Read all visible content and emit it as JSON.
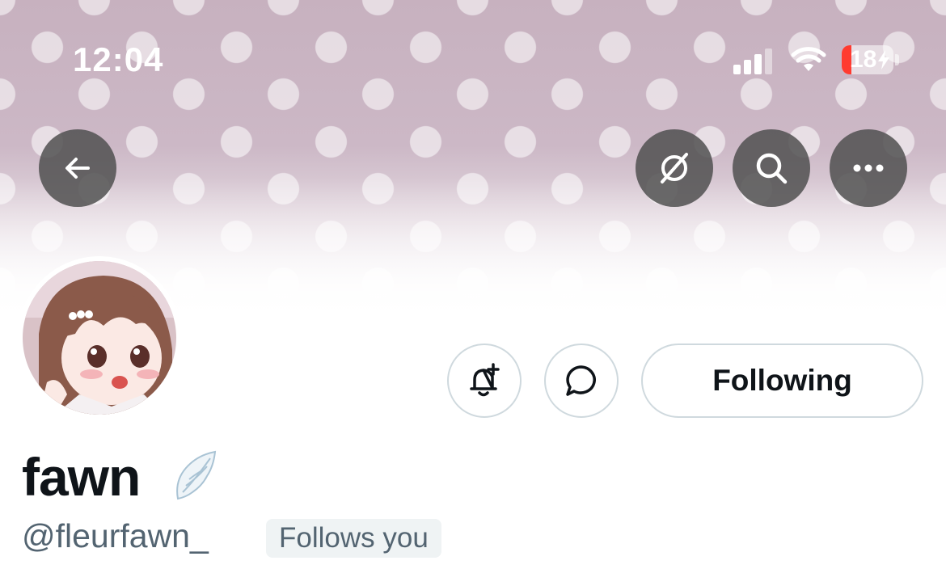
{
  "status_bar": {
    "time": "12:04",
    "battery_level": "18",
    "battery_percent": 18,
    "battery_color": "#ff3b30"
  },
  "nav": {
    "back_icon": "arrow-left-icon",
    "translate_icon": "globe-slash-icon",
    "search_icon": "search-icon",
    "more_icon": "more-horizontal-icon"
  },
  "profile": {
    "display_name": "fawn",
    "name_emoji": "wing-emoji",
    "handle": "@fleurfawn_",
    "follows_you_label": "Follows you"
  },
  "actions": {
    "notify_icon": "bell-plus-icon",
    "message_icon": "message-bubble-icon",
    "following_label": "Following"
  },
  "colors": {
    "text_primary": "#0f1419",
    "text_secondary": "#536471",
    "border": "#cfd9de",
    "badge_bg": "#eff3f4",
    "banner": "#c7b1bf"
  }
}
